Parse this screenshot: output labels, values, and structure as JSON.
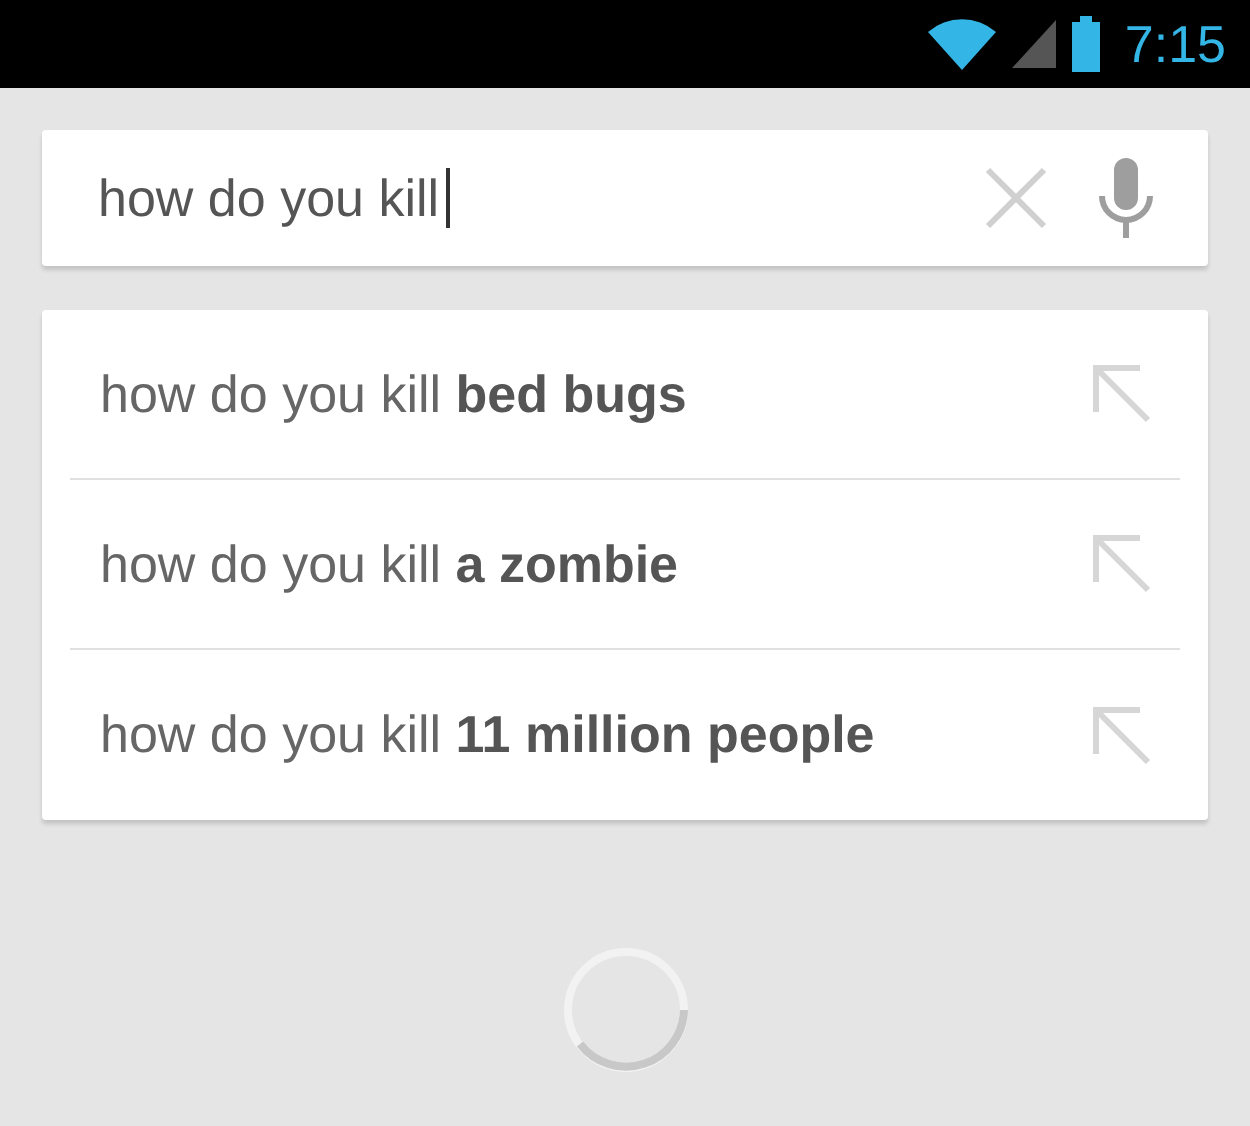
{
  "status_bar": {
    "time": "7:15"
  },
  "search": {
    "value": "how do you kill"
  },
  "suggestions": [
    {
      "text": "how do you kill **bed bugs**"
    },
    {
      "text": "how do you kill **a zombie**"
    },
    {
      "text": "how do you kill **11 million people**"
    }
  ]
}
